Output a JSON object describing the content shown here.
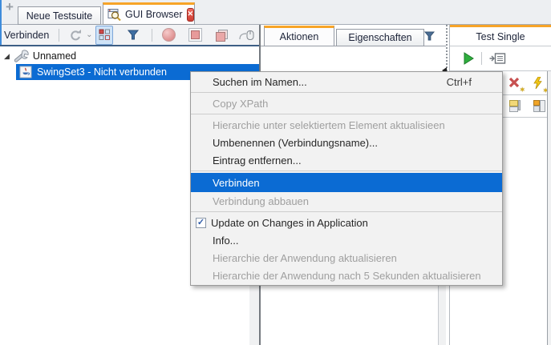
{
  "colors": {
    "accent_orange": "#f7a428",
    "selection_blue": "#0b6bd3",
    "close_red": "#cf3d33",
    "filter_blue": "#3f6fa3",
    "play_green": "#2fae3e",
    "toolbar_border_navy": "#3d5e85"
  },
  "icons": {
    "add_tab": "+",
    "close": "✕",
    "checkmark": "✓",
    "expand_marker": "◢",
    "dropdown_chevron": "⌄",
    "badge_star": "✶"
  },
  "tab_strip": {
    "tabs": [
      {
        "label": "Neue Testsuite",
        "active": false
      },
      {
        "label": "GUI Browser",
        "active": true
      }
    ]
  },
  "left_toolbar": {
    "connect_label": "Verbinden"
  },
  "tree": {
    "items": [
      {
        "label": "Unnamed",
        "expanded": true
      },
      {
        "label": "SwingSet3 - Nicht verbunden",
        "selected": true
      }
    ]
  },
  "mid_panel": {
    "tabs": [
      {
        "label": "Aktionen",
        "active": true
      },
      {
        "label": "Eigenschaften",
        "active": false
      }
    ]
  },
  "right_panel": {
    "title": "Test Single"
  },
  "context_menu": {
    "items": [
      {
        "label": "Suchen im Namen...",
        "shortcut": "Ctrl+f",
        "enabled": true
      },
      {
        "label": "Copy XPath",
        "enabled": false
      },
      {
        "label": "Hierarchie unter selektiertem Element aktualisieen",
        "enabled": false
      },
      {
        "label": "Umbenennen (Verbindungsname)...",
        "enabled": true
      },
      {
        "label": "Eintrag entfernen...",
        "enabled": true
      },
      {
        "label": "Verbinden",
        "enabled": true,
        "highlighted": true
      },
      {
        "label": "Verbindung abbauen",
        "enabled": false
      },
      {
        "label": "Update on Changes in Application",
        "enabled": true,
        "checked": true
      },
      {
        "label": "Info...",
        "enabled": true
      },
      {
        "label": "Hierarchie der Anwendung aktualisieren",
        "enabled": false
      },
      {
        "label": "Hierarchie der Anwendung nach 5 Sekunden aktualisieren",
        "enabled": false
      }
    ]
  }
}
